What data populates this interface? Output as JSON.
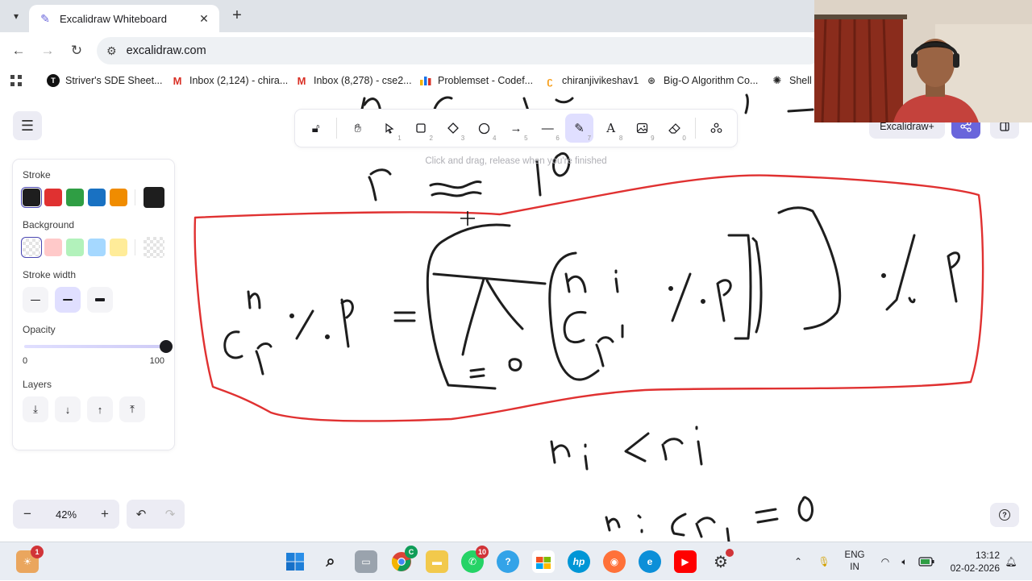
{
  "browser": {
    "tab_title": "Excalidraw Whiteboard",
    "url": "excalidraw.com",
    "bookmarks": [
      {
        "label": "Striver's SDE Sheet...",
        "icon": "tuf-icon",
        "color": "#111111"
      },
      {
        "label": "Inbox (2,124) - chira...",
        "icon": "gmail-icon",
        "color": "#d93025"
      },
      {
        "label": "Inbox (8,278) - cse2...",
        "icon": "gmail-icon",
        "color": "#d93025"
      },
      {
        "label": "Problemset - Codef...",
        "icon": "codeforces-icon",
        "color": "#f4b400"
      },
      {
        "label": "chiranjivikeshav1",
        "icon": "leetcode-icon",
        "color": "#f89f1b"
      },
      {
        "label": "Big-O Algorithm Co...",
        "icon": "bigo-icon",
        "color": "#555555"
      },
      {
        "label": "Shell v",
        "icon": "chatgpt-icon",
        "color": "#222222"
      }
    ]
  },
  "excalidraw": {
    "hint": "Click and drag, release when you're finished",
    "toolbar_keys": [
      "",
      "",
      "1",
      "2",
      "3",
      "4",
      "5",
      "6",
      "7",
      "8",
      "9",
      "0",
      ""
    ],
    "props": {
      "stroke_title": "Stroke",
      "background_title": "Background",
      "stroke_width_title": "Stroke width",
      "opacity_title": "Opacity",
      "opacity_min": "0",
      "opacity_max": "100",
      "opacity_value": 100,
      "layers_title": "Layers",
      "stroke_colors": [
        "#1e1e1e",
        "#e03131",
        "#2f9e44",
        "#1971c2",
        "#f08c00"
      ],
      "background_colors": [
        "transparent",
        "#ffc9c9",
        "#b2f2bb",
        "#a5d8ff",
        "#ffec99"
      ],
      "selected_stroke": "#1e1e1e"
    },
    "zoom": "42%",
    "excalidraw_plus": "Excalidraw+"
  },
  "taskbar": {
    "chrome_badge": "C",
    "whatsapp_badge": "10",
    "lang_line1": "ENG",
    "lang_line2": "IN",
    "time": "13:12",
    "date": "02-02-2026"
  }
}
